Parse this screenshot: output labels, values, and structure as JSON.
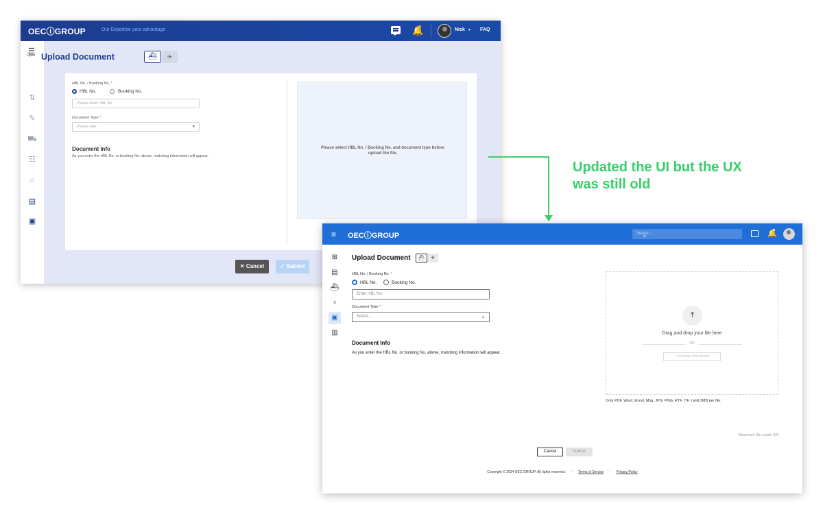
{
  "old_ui": {
    "logo": "OECⓘGROUP",
    "tagline": "Our Expertise your advantage",
    "user_name": "Nick",
    "faq_label": "FAQ",
    "sidebar_open_label": "Open",
    "page_title": "Upload Document",
    "form": {
      "ref_label": "HBL No. / Booking No.",
      "required_mark": "*",
      "radio_hbl": "HBL No.",
      "radio_booking": "Booking No.",
      "ref_placeholder": "Please enter HBL No.",
      "doc_type_label": "Document Type",
      "doc_type_placeholder": "Please sele",
      "doc_info_title": "Document Info",
      "doc_info_desc": "As you enter the HBL No. or booking No. above, matching information will appear."
    },
    "dropzone_message": "Please select HBL No. / Booking No. and document type before upload the file.",
    "cancel_label": "✕ Cancel",
    "submit_label": "✓ Submit",
    "colors": {
      "header": "#1d3c8f",
      "background": "#e3e6f6",
      "accent": "#1d3c8f"
    }
  },
  "annotation": {
    "text": "Updated the UI but the UX was still old",
    "color": "#35d06a"
  },
  "new_ui": {
    "logo": "OECⓘGROUP",
    "search_placeholder": "Search...",
    "page_title": "Upload Document",
    "form": {
      "ref_label": "HBL No. / Booking No.",
      "required_mark": "*",
      "radio_hbl": "HBL No.",
      "radio_booking": "Booking No.",
      "ref_placeholder": "Enter HBL No.",
      "doc_type_label": "Document Type",
      "doc_type_placeholder": "Select...",
      "doc_info_title": "Document Info",
      "doc_info_desc": "As you enter the HBL No. or booking No. above, matching information will appear."
    },
    "dropzone": {
      "message": "Drag and drop your file here",
      "or_label": "OR",
      "choose_label": "+ Choose Document",
      "limits": "Only PDF, Word, Excel, Msg, JPG, PNG, RTF, TIF. Limit 2MB per file."
    },
    "max_file_count": "Maximum file count: 0/3",
    "cancel_label": "Cancel",
    "submit_label": "Submit",
    "footer": {
      "copyright": "Copyright © 2024 OEC GROUP. All rights reserved.",
      "terms": "Terms of Service",
      "privacy": "Privacy Policy",
      "separator": "-"
    },
    "colors": {
      "header": "#1f6fd6",
      "accent": "#1f6fd6"
    }
  }
}
